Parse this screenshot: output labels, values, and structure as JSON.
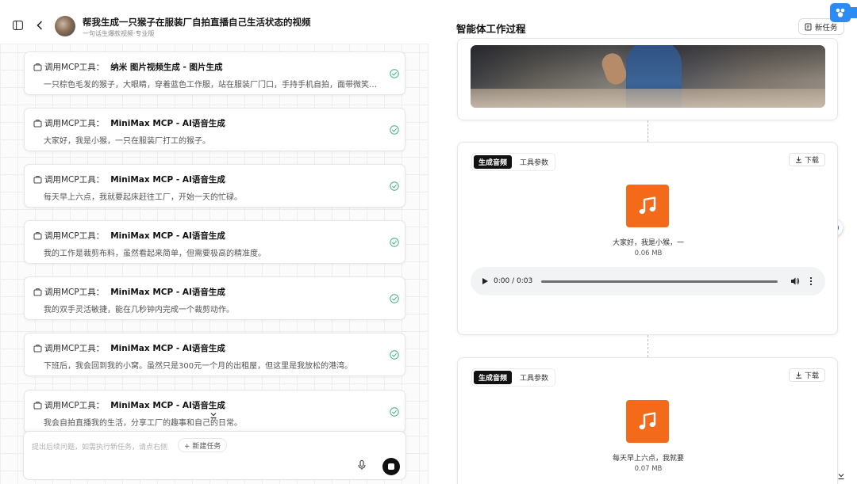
{
  "header": {
    "title": "帮我生成一只猴子在服装厂自拍直播自己生活状态的视频",
    "subtitle": "一句话生爆款视频·专业版"
  },
  "tool_prefix": "调用MCP工具：",
  "tool_calls": [
    {
      "tool": "纳米 图片视频生成 - 图片生成",
      "text": "一只棕色毛发的猴子，大眼睛，穿着蓝色工作服，站在服装厂门口，手持手机自拍，面带微笑，背景是服装厂的大门和一些工人。"
    },
    {
      "tool": "MiniMax MCP - AI语音生成",
      "text": "大家好，我是小猴，一只在服装厂打工的猴子。"
    },
    {
      "tool": "MiniMax MCP - AI语音生成",
      "text": "每天早上六点，我就要起床赶往工厂，开始一天的忙碌。"
    },
    {
      "tool": "MiniMax MCP - AI语音生成",
      "text": "我的工作是裁剪布料，虽然看起来简单，但需要极高的精准度。"
    },
    {
      "tool": "MiniMax MCP - AI语音生成",
      "text": "我的双手灵活敏捷，能在几秒钟内完成一个裁剪动作。"
    },
    {
      "tool": "MiniMax MCP - AI语音生成",
      "text": "下班后，我会回到我的小窝。虽然只是300元一个月的出租屋，但这里是我放松的港湾。"
    },
    {
      "tool": "MiniMax MCP - AI语音生成",
      "text": "我会自拍直播我的生活，分享工厂的趣事和自己的日常。"
    }
  ],
  "composer": {
    "placeholder": "提出后续问题，如需执行新任务，请点右侧",
    "new_task_chip": "+ 新建任务"
  },
  "right": {
    "title": "智能体工作过程",
    "new_task_button": "新任务",
    "audio_cards": [
      {
        "tab_active": "生成音频",
        "tab_other": "工具参数",
        "download": "下载",
        "caption": "大家好，我是小猴，一",
        "size": "0.06 MB",
        "time": "0:00 / 0:03"
      },
      {
        "tab_active": "生成音频",
        "tab_other": "工具参数",
        "download": "下载",
        "caption": "每天早上六点，我就要",
        "size": "0.07 MB"
      }
    ]
  },
  "colors": {
    "accent": "#f36a1a",
    "success": "#3cb37a",
    "brand_blue": "#2c8cf4"
  }
}
